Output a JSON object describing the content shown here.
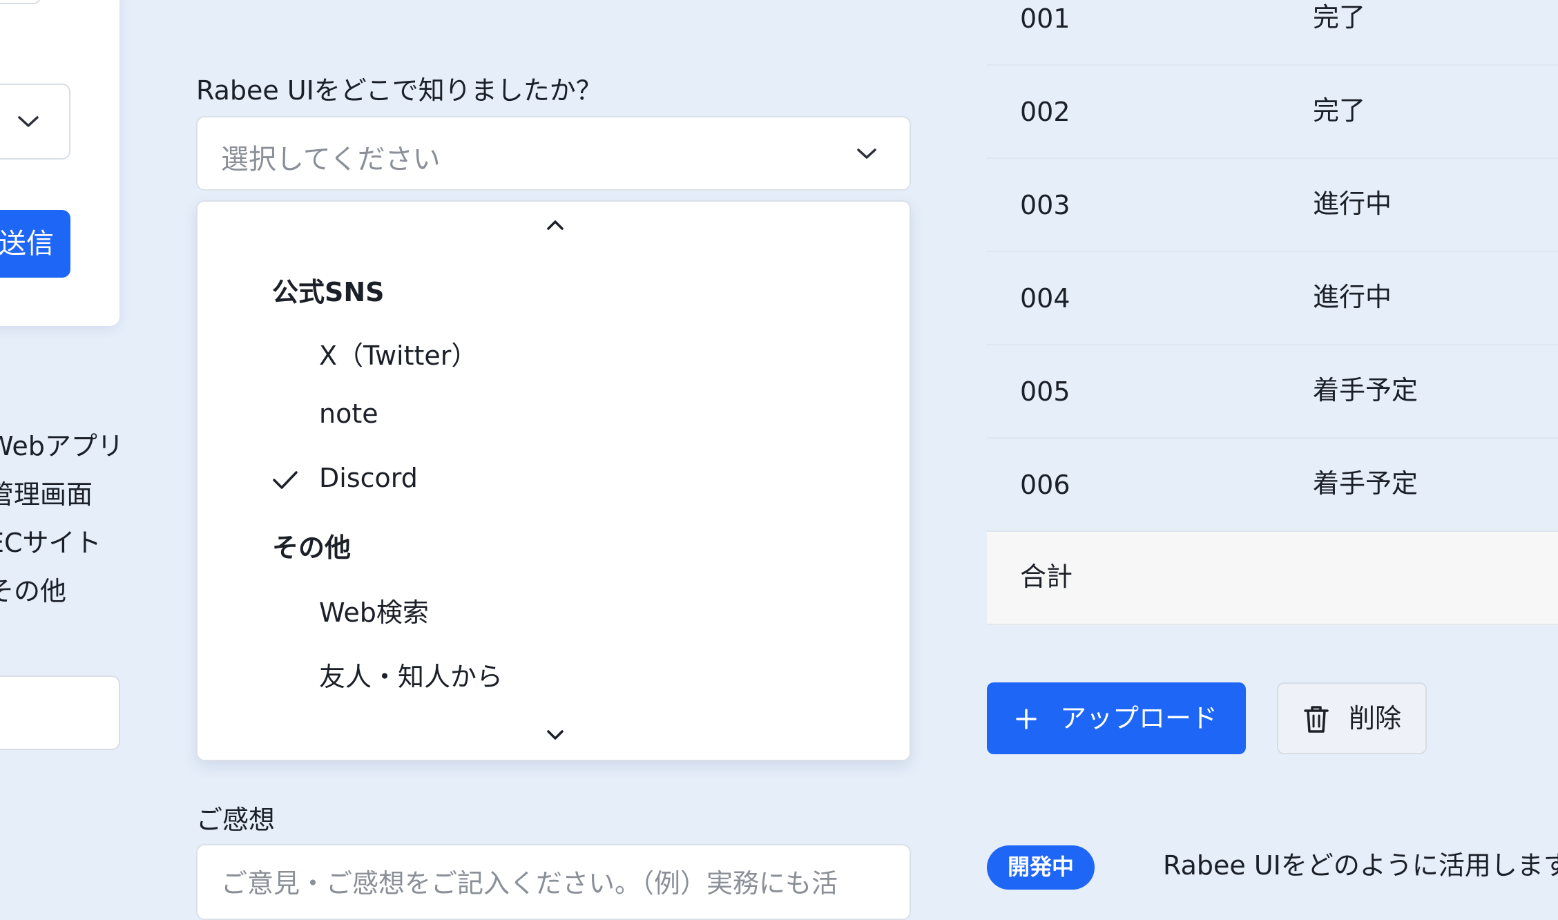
{
  "left_panel": {
    "send_button": "送信",
    "chevron_icon": "chevron-down-icon",
    "list_items": [
      "Webアプリ",
      "管理画面",
      "ECサイト",
      "その他"
    ]
  },
  "form": {
    "question_label": "Rabee UIをどこで知りましたか？",
    "select_placeholder": "選択してください",
    "dropdown": {
      "groups": [
        {
          "label": "公式SNS",
          "options": [
            {
              "label": "X（Twitter）",
              "selected": false
            },
            {
              "label": "note",
              "selected": false
            },
            {
              "label": "Discord",
              "selected": true
            }
          ]
        },
        {
          "label": "その他",
          "options": [
            {
              "label": "Web検索",
              "selected": false
            },
            {
              "label": "友人・知人から",
              "selected": false
            }
          ]
        }
      ]
    },
    "feedback_label": "ご感想",
    "feedback_placeholder": "ご意見・ご感想をご記入ください。（例）実務にも活"
  },
  "table": {
    "rows": [
      {
        "id": "001",
        "status": "完了"
      },
      {
        "id": "002",
        "status": "完了"
      },
      {
        "id": "003",
        "status": "進行中"
      },
      {
        "id": "004",
        "status": "進行中"
      },
      {
        "id": "005",
        "status": "着手予定"
      },
      {
        "id": "006",
        "status": "着手予定"
      }
    ],
    "total_label": "合計"
  },
  "actions": {
    "upload_label": "アップロード",
    "delete_label": "削除"
  },
  "bottom": {
    "badge": "開発中",
    "text": "Rabee UIをどのように活用します"
  },
  "colors": {
    "accent": "#1e66f5",
    "background": "#e6eef9"
  }
}
